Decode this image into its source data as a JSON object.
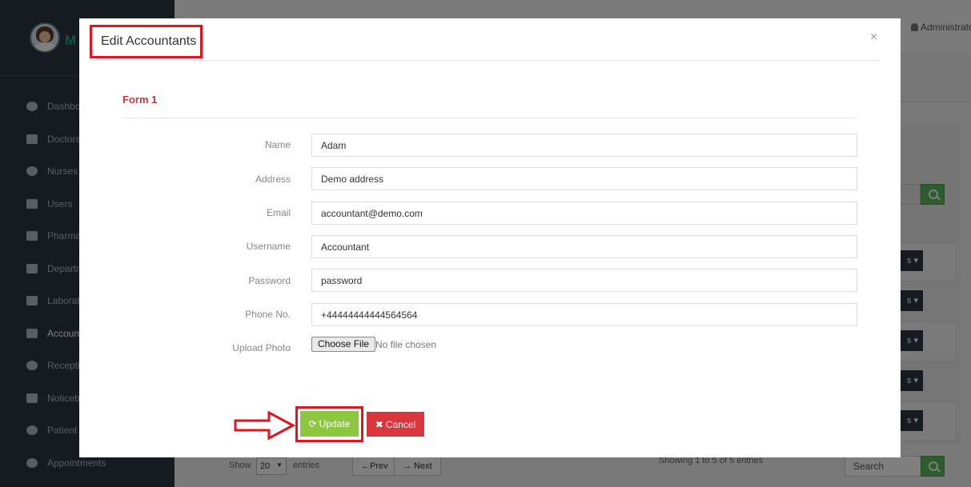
{
  "app": {
    "brand_name": "M"
  },
  "sidebar": {
    "items": [
      {
        "label": "Dashbo",
        "icon": "dashboard-icon"
      },
      {
        "label": "Doctors",
        "icon": "user-md-icon"
      },
      {
        "label": "Nurses",
        "icon": "stethoscope-icon"
      },
      {
        "label": "Users",
        "icon": "user-icon"
      },
      {
        "label": "Pharma",
        "icon": "plus-square-icon"
      },
      {
        "label": "Departm",
        "icon": "briefcase-icon"
      },
      {
        "label": "Laborato",
        "icon": "flask-icon"
      },
      {
        "label": "Account",
        "icon": "money-icon",
        "active": true
      },
      {
        "label": "Receptio",
        "icon": "female-icon"
      },
      {
        "label": "Noticebo",
        "icon": "file-icon"
      },
      {
        "label": "Patient",
        "icon": "male-icon"
      },
      {
        "label": "Appointments",
        "icon": "dashboard-icon"
      }
    ]
  },
  "header": {
    "user_label": "Administrato"
  },
  "table": {
    "action_caret": "s ▾",
    "show_label": "Show",
    "entries_value": "20",
    "entries_label": "entries",
    "prev_label": "←Prev",
    "next_label": "→ Next",
    "showing_text": "Showing 1 to 5 of 5 entries",
    "search_placeholder": "Search"
  },
  "modal": {
    "title": "Edit Accountants",
    "close_glyph": "×",
    "form_title": "Form 1",
    "fields": [
      {
        "label": "Name",
        "value": "Adam"
      },
      {
        "label": "Address",
        "value": "Demo address"
      },
      {
        "label": "Email",
        "value": "accountant@demo.com"
      },
      {
        "label": "Username",
        "value": "Accountant"
      },
      {
        "label": "Password",
        "value": "password"
      },
      {
        "label": "Phone No.",
        "value": "+44444444444564564"
      }
    ],
    "upload_label": "Upload Photo",
    "file_button": "Choose File",
    "file_status": "No file chosen",
    "update_label": "Update",
    "cancel_label": "Cancel"
  },
  "colors": {
    "sidebar_bg": "#2b3643",
    "update_green": "#8dc63f",
    "cancel_red": "#d9363e",
    "highlight_red": "#e3141c",
    "form_title_red": "#c7363c"
  }
}
